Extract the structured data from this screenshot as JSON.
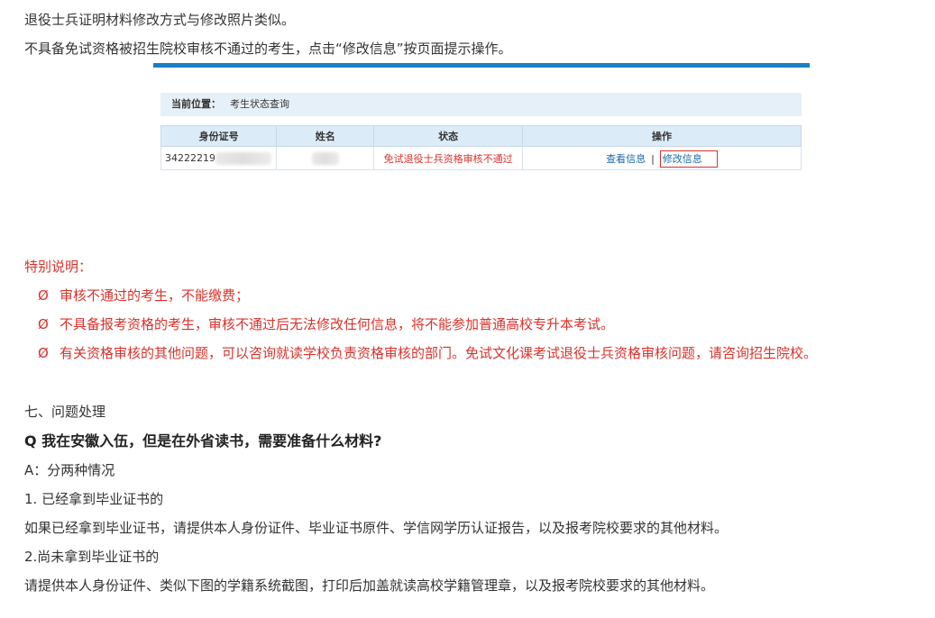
{
  "paragraphs": {
    "p1": "退役士兵证明材料修改方式与修改照片类似。",
    "p2": "不具备免试资格被招生院校审核不通过的考生，点击“修改信息”按页面提示操作。"
  },
  "screenshot": {
    "breadcrumb_label": "当前位置：",
    "breadcrumb_value": "考生状态查询",
    "columns": [
      "身份证号",
      "姓名",
      "状态",
      "操作"
    ],
    "row": {
      "id_number": "34222219",
      "name": "",
      "status": "免试退役士兵资格审核不通过",
      "view_label": "查看信息",
      "separator": "|",
      "edit_label": "修改信息"
    },
    "colors": {
      "accent_bar": "#1a7fc4",
      "status_red": "#d9322b",
      "link_blue": "#1a6aa8"
    }
  },
  "special": {
    "title": "特别说明：",
    "bullet_symbol": "Ø",
    "items": [
      "审核不通过的考生，不能缴费；",
      "不具备报考资格的考生，审核不通过后无法修改任何信息，将不能参加普通高校专升本考试。",
      "有关资格审核的其他问题，可以咨询就读学校负责资格审核的部门。免试文化课考试退役士兵资格审核问题，请咨询招生院校。"
    ]
  },
  "section7": {
    "heading": "七、问题处理",
    "question": "Q 我在安徽入伍，但是在外省读书，需要准备什么材料?",
    "answer_intro": "A：分两种情况",
    "case1_title": "1. 已经拿到毕业证书的",
    "case1_text": "如果已经拿到毕业证书，请提供本人身份证件、毕业证书原件、学信网学历认证报告，以及报考院校要求的其他材料。",
    "case2_title": "2.尚未拿到毕业证书的",
    "case2_text": "请提供本人身份证件、类似下图的学籍系统截图，打印后加盖就读高校学籍管理章，以及报考院校要求的其他材料。"
  }
}
